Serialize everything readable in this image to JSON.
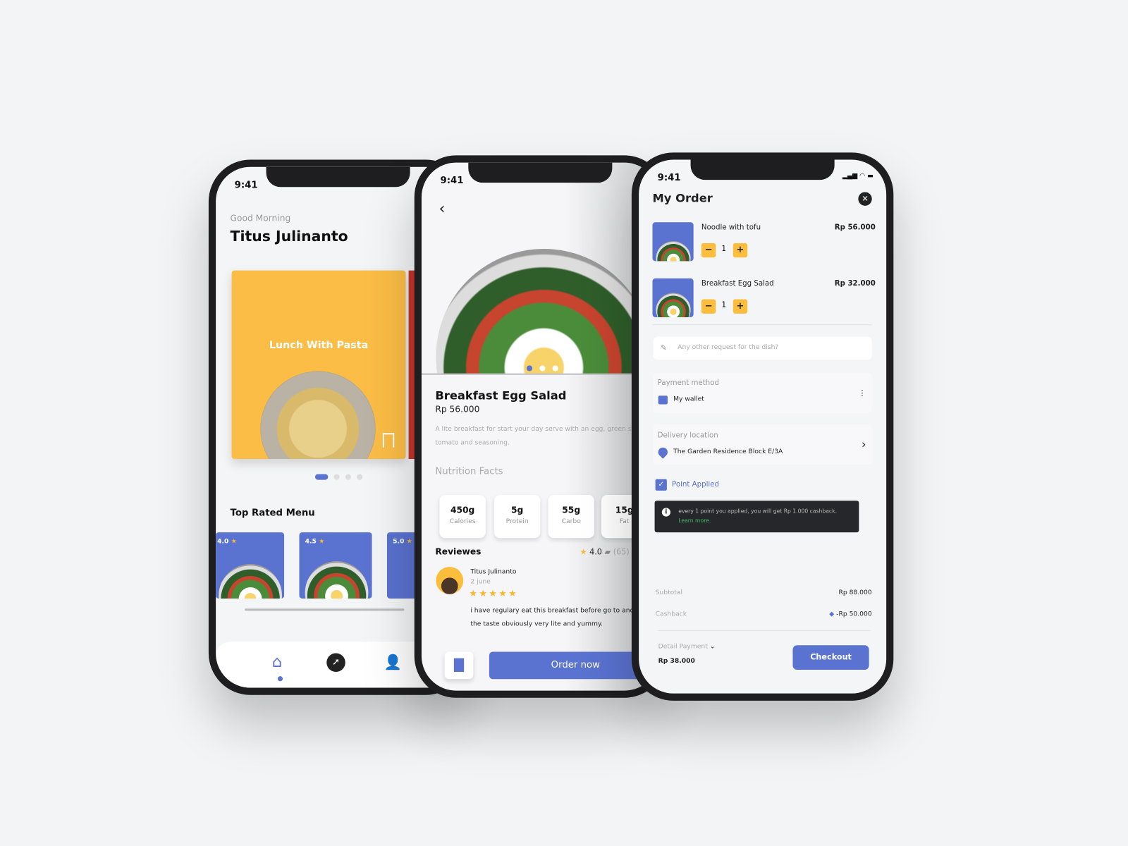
{
  "status_time": "9:41",
  "colors": {
    "accent": "#5a72d0",
    "yellow": "#fbbd3c",
    "dark": "#25272a"
  },
  "home": {
    "greeting": "Good Morning",
    "user_name": "Titus Julinanto",
    "featured_title": "Lunch With Pasta",
    "carousel_count": 4,
    "carousel_active": 1,
    "section_title": "Top Rated Menu",
    "top_rated": [
      {
        "rating": "4.0"
      },
      {
        "rating": "4.5"
      },
      {
        "rating": "5.0"
      }
    ],
    "nav": [
      "home-icon",
      "compass-icon",
      "user-icon"
    ]
  },
  "detail": {
    "title": "Breakfast Egg Salad",
    "price": "Rp 56.000",
    "description": "A lite breakfast for start your day serve with an egg, green salad, tomato and seasoning.",
    "nutrition_title": "Nutrition Facts",
    "nutrition": [
      {
        "value": "450g",
        "label": "Calories"
      },
      {
        "value": "5g",
        "label": "Protein"
      },
      {
        "value": "55g",
        "label": "Carbo"
      },
      {
        "value": "15g",
        "label": "Fat"
      }
    ],
    "reviews_title": "Reviewes",
    "rating": "4.0",
    "review_count": "(65)",
    "review": {
      "name": "Titus Julinanto",
      "date": "2 june",
      "stars": 5,
      "text": "i have regulary eat this breakfast before go to and the taste obviously very lite and yummy."
    },
    "order_button": "Order now"
  },
  "order": {
    "title": "My Order",
    "items": [
      {
        "name": "Noodle with tofu",
        "price": "Rp 56.000",
        "qty": "1"
      },
      {
        "name": "Breakfast Egg Salad",
        "price": "Rp 32.000",
        "qty": "1"
      }
    ],
    "request_placeholder": "Any other request for the dish?",
    "payment_label": "Payment method",
    "payment_value": "My wallet",
    "delivery_label": "Delivery location",
    "delivery_value": "The Garden Residence Block E/3A",
    "point_label": "Point Applied",
    "point_checked": true,
    "info_text": "every 1 point you applied,  you will get Rp 1.000 cashback.",
    "info_link": "Learn more.",
    "subtotal_label": "Subtotal",
    "subtotal": "Rp 88.000",
    "cashback_label": "Cashback",
    "cashback": "-Rp 50.000",
    "detail_label": "Detail Payment",
    "total": "Rp 38.000",
    "checkout": "Checkout"
  }
}
